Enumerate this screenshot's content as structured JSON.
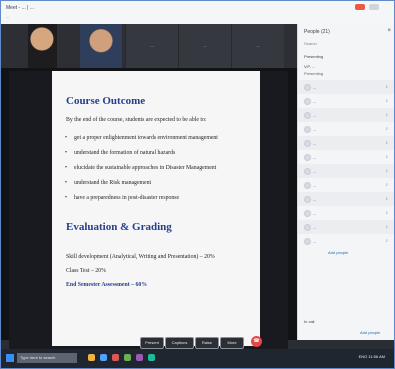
{
  "browser": {
    "tabs": "Meet - ... | ...",
    "bookmarks": "..."
  },
  "video": {
    "tiles": [
      "...",
      "...",
      "..."
    ]
  },
  "slide": {
    "course_outcome_title": "Course Outcome",
    "intro": "By the end of the course, students are expected to be able to:",
    "bullets": [
      "get a proper enlightenment towards environment management",
      "understand the formation of natural hazards",
      "elucidate the sustainable approaches in Disaster Management",
      "understand the Risk management",
      "have a preparedness in post-disaster response"
    ],
    "evaluation_title": "Evaluation & Grading",
    "skill_line": "Skill development (Analytical, Writing and Presentation) – 20%",
    "class_test_line": "Class Test – 20%",
    "end_sem_line": "End Semester Assessment – 60%"
  },
  "meeting_bar": {
    "buttons": [
      "Present",
      "Captions",
      "Raise",
      "More"
    ],
    "end_call_icon": "phone-end-icon"
  },
  "panel": {
    "title": "People (21)",
    "search_placeholder": "Search",
    "group_label": "Presenting",
    "presenter_name": "V.P. ...",
    "presenter_sub": "Presenting",
    "people": [
      "...",
      "...",
      "...",
      "...",
      "...",
      "...",
      "...",
      "...",
      "...",
      "...",
      "...",
      "..."
    ],
    "add_people": "Add people",
    "bottom_label": "In call",
    "bottom_action": "Add people"
  },
  "taskbar": {
    "search": "Type here to search",
    "tray": "ENG 11:56 AM"
  },
  "colors": {
    "accent": "#253f8c",
    "end_call": "#e34848"
  }
}
